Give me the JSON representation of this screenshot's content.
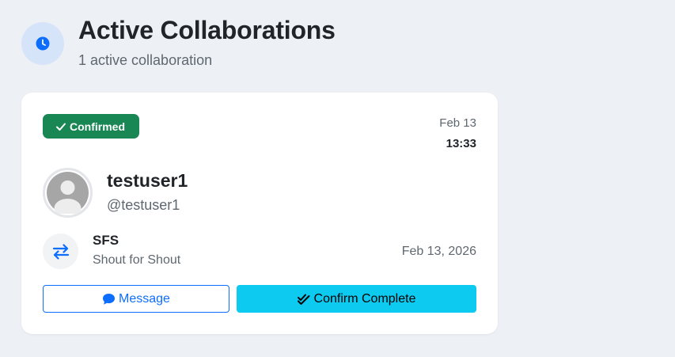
{
  "header": {
    "icon": "clock-icon",
    "title": "Active Collaborations",
    "subtitle": "1 active collaboration"
  },
  "collaboration": {
    "status": "Confirmed",
    "status_color": "#198754",
    "date": "Feb 13",
    "time": "13:33",
    "user": {
      "name": "testuser1",
      "handle": "@testuser1",
      "avatar": "default-avatar-icon"
    },
    "type": "SFS",
    "type_description": "Shout for Shout",
    "scheduled_date": "Feb 13, 2026",
    "actions": {
      "message_label": "Message",
      "confirm_label": "Confirm Complete"
    }
  },
  "colors": {
    "accent": "#0d6efd",
    "confirm_button": "#0dcaf0",
    "background": "#edf0f5"
  }
}
